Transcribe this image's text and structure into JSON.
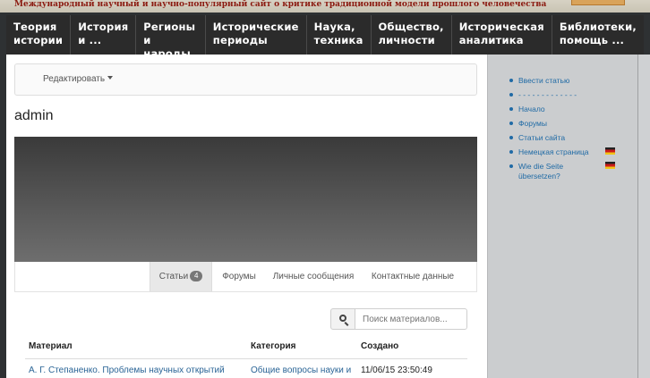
{
  "header": {
    "tagline": "Международный научный и научно-популярный сайт о критике традиционной модели прошлого человечества"
  },
  "nav": {
    "items": [
      {
        "line1": "Теория",
        "line2": "истории"
      },
      {
        "line1": "История",
        "line2": "и ..."
      },
      {
        "line1": "Регионы и",
        "line2": "народы"
      },
      {
        "line1": "Исторические",
        "line2": "периоды"
      },
      {
        "line1": "Наука,",
        "line2": "техника"
      },
      {
        "line1": "Общество,",
        "line2": "личности"
      },
      {
        "line1": "Историческая",
        "line2": "аналитика"
      },
      {
        "line1": "Библиотеки,",
        "line2": "помощь ..."
      }
    ]
  },
  "toolbar": {
    "edit_label": "Редактировать"
  },
  "profile": {
    "username": "admin"
  },
  "tabs": [
    {
      "label": "Статьи",
      "badge": "4"
    },
    {
      "label": "Форумы"
    },
    {
      "label": "Личные сообщения"
    },
    {
      "label": "Контактные данные"
    }
  ],
  "search": {
    "placeholder": "Поиск материалов..."
  },
  "table": {
    "headers": [
      "Материал",
      "Категория",
      "Создано"
    ],
    "rows": [
      [
        "А. Г. Степаненко. Проблемы научных открытий",
        "Общие вопросы науки и",
        "11/06/15 23:50:49"
      ]
    ]
  },
  "sidebar": {
    "items": [
      {
        "label": "Ввести статью"
      },
      {
        "label": "- - - - - - - - - - - - -"
      },
      {
        "label": "Начало"
      },
      {
        "label": "Форумы"
      },
      {
        "label": "Статьи сайта"
      },
      {
        "label": "Немецкая страница",
        "flag": "german-flag-icon"
      },
      {
        "label": "Wie die Seite übersetzen?",
        "flag": "german-flag-icon"
      }
    ]
  },
  "colors": {
    "nav_bg": "#2b2b2b",
    "link": "#2a6496",
    "tagline": "#8b1a10",
    "sidebar_bg": "#cbcdcf"
  }
}
